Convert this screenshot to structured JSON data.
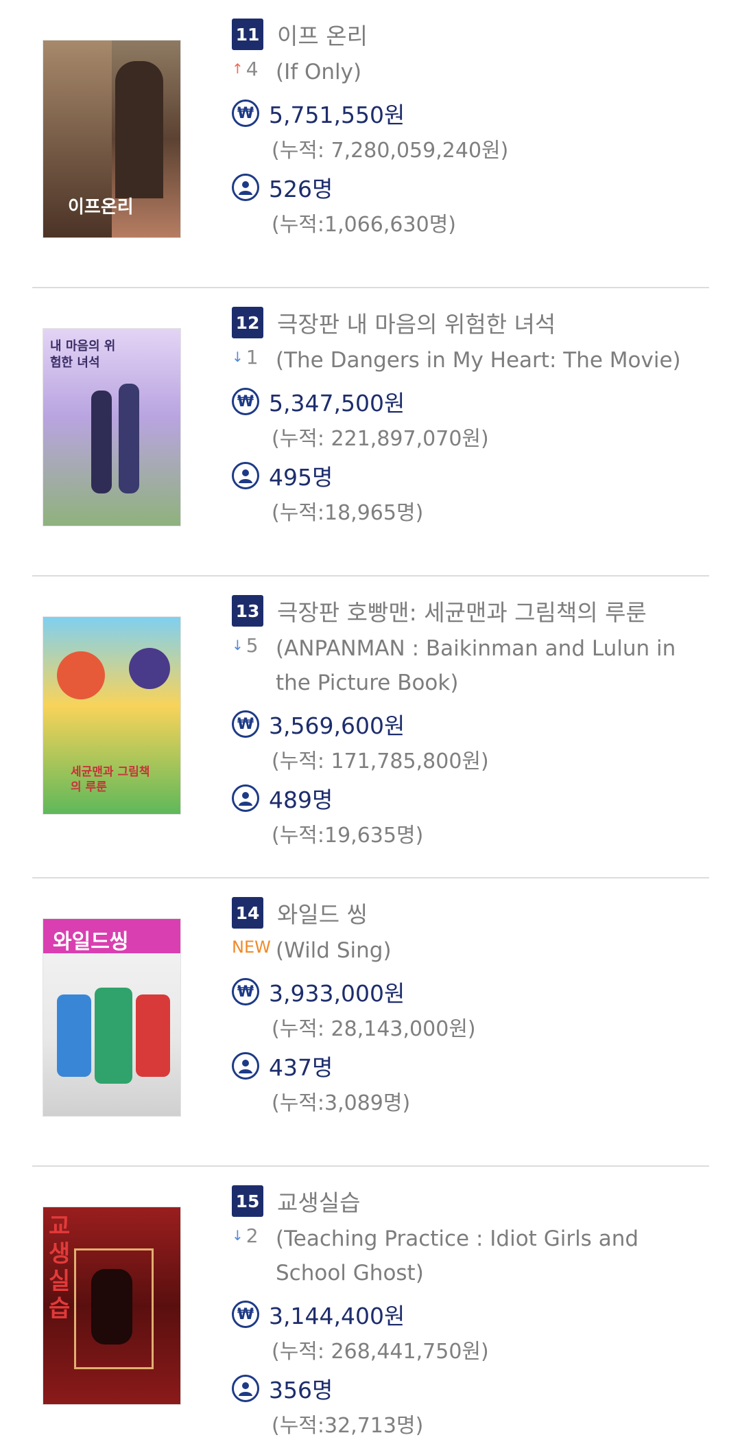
{
  "movies": [
    {
      "rank": "11",
      "title_kr": "이프 온리",
      "change_dir": "up",
      "change_arrow": "↑",
      "change_value": "4",
      "title_en": "(If Only)",
      "revenue": "5,751,550원",
      "revenue_acc": "(누적: 7,280,059,240원)",
      "audience": "526명",
      "audience_acc": "(누적:1,066,630명)",
      "poster_text": "이프온리",
      "poster_colors": [
        "#9a7356",
        "#3e2a20",
        "#c48c6e"
      ]
    },
    {
      "rank": "12",
      "title_kr": "극장판 내 마음의 위험한 녀석",
      "change_dir": "down",
      "change_arrow": "↓",
      "change_value": "1",
      "title_en": "(The Dangers in My Heart: The Movie)",
      "revenue": "5,347,500원",
      "revenue_acc": "(누적: 221,897,070원)",
      "audience": "495명",
      "audience_acc": "(누적:18,965명)",
      "poster_text": "내 마음의 위험한 녀석",
      "poster_colors": [
        "#d6c4f0",
        "#7a6bb6",
        "#9dbf8a"
      ]
    },
    {
      "rank": "13",
      "title_kr": "극장판 호빵맨: 세균맨과 그림책의 루룬",
      "change_dir": "down",
      "change_arrow": "↓",
      "change_value": "5",
      "title_en": "(ANPANMAN : Baikinman and Lulun in the Picture Book)",
      "revenue": "3,569,600원",
      "revenue_acc": "(누적: 171,785,800원)",
      "audience": "489명",
      "audience_acc": "(누적:19,635명)",
      "poster_text": "세균맨과 그림책의 루룬",
      "poster_colors": [
        "#6cc6ea",
        "#f2a33a",
        "#4ba64a"
      ]
    },
    {
      "rank": "14",
      "title_kr": "와일드 씽",
      "change_dir": "new",
      "change_arrow": "",
      "change_value": "NEW",
      "title_en": "(Wild Sing)",
      "revenue": "3,933,000원",
      "revenue_acc": "(누적: 28,143,000원)",
      "audience": "437명",
      "audience_acc": "(누적:3,089명)",
      "poster_text": "와일드씽",
      "poster_colors": [
        "#c63aa3",
        "#f2f2f2",
        "#2fa36b"
      ]
    },
    {
      "rank": "15",
      "title_kr": "교생실습",
      "change_dir": "down",
      "change_arrow": "↓",
      "change_value": "2",
      "title_en": "(Teaching Practice : Idiot Girls and School Ghost)",
      "revenue": "3,144,400원",
      "revenue_acc": "(누적: 268,441,750원)",
      "audience": "356명",
      "audience_acc": "(누적:32,713명)",
      "poster_text": "교생실습",
      "poster_colors": [
        "#8b1a1a",
        "#2a0c0c",
        "#d23b2a"
      ]
    }
  ],
  "icons": {
    "revenue": "won-icon",
    "audience": "person-icon"
  }
}
